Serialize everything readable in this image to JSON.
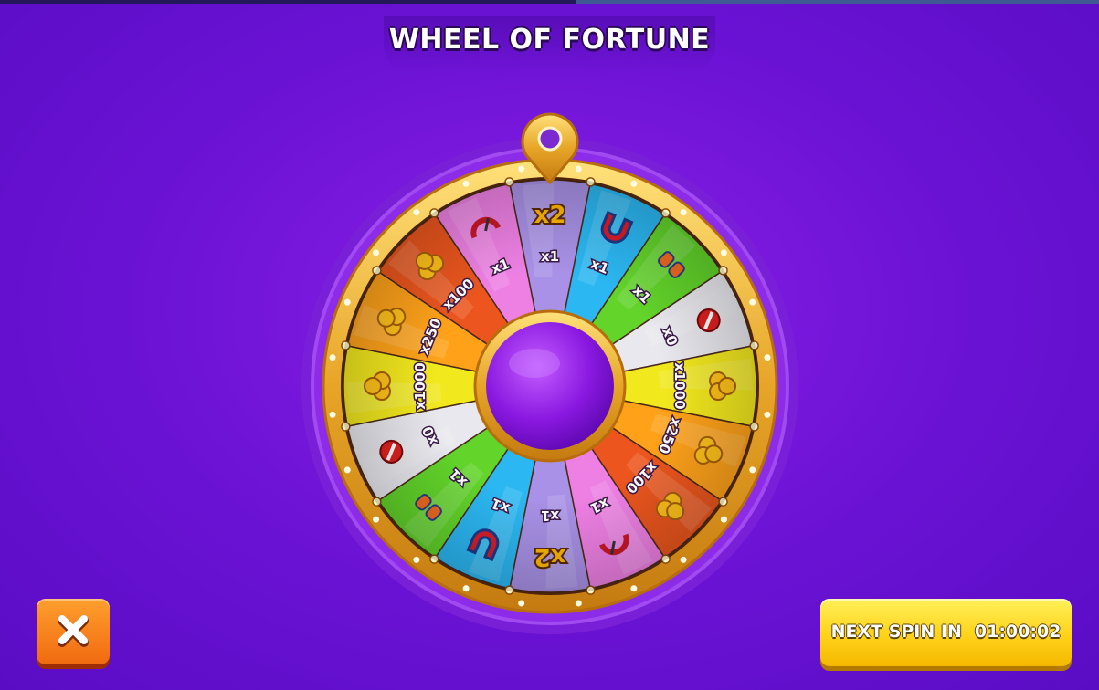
{
  "title": "WHEEL OF FORTUNE",
  "wheel": {
    "segments": [
      {
        "label": "x2",
        "icon": "x2-badge",
        "color": "#a891e6"
      },
      {
        "label": "x1",
        "icon": "magnet-icon",
        "color": "#2bb7f2"
      },
      {
        "label": "x1",
        "icon": "binoculars-icon",
        "color": "#62d42a"
      },
      {
        "label": "x0",
        "icon": "no-entry-icon",
        "color": "#e8e8ee"
      },
      {
        "label": "x1000",
        "icon": "treasure-coins-icon",
        "color": "#f2e81e"
      },
      {
        "label": "x250",
        "icon": "coins-pile-icon",
        "color": "#ffa21a"
      },
      {
        "label": "x100",
        "icon": "coins-icon",
        "color": "#ec561e"
      },
      {
        "label": "x1",
        "icon": "speedometer-icon",
        "color": "#ee80e4"
      },
      {
        "label": "x1",
        "icon": "x2-badge",
        "color": "#a891e6"
      },
      {
        "label": "x1",
        "icon": "magnet-icon",
        "color": "#2bb7f2"
      },
      {
        "label": "x1",
        "icon": "binoculars-icon",
        "color": "#62d42a"
      },
      {
        "label": "x0",
        "icon": "no-entry-icon",
        "color": "#e8e8ee"
      },
      {
        "label": "x1000",
        "icon": "treasure-coins-icon",
        "color": "#f2e81e"
      },
      {
        "label": "x250",
        "icon": "coins-pile-icon",
        "color": "#ffa21a"
      },
      {
        "label": "x100",
        "icon": "coins-icon",
        "color": "#ec561e"
      },
      {
        "label": "x1",
        "icon": "speedometer-icon",
        "color": "#ee80e4"
      }
    ],
    "badge_top": "x2",
    "badge_bottom": "x2"
  },
  "close_button": {
    "icon": "close-icon",
    "color": "#f47a18"
  },
  "next_spin": {
    "label": "NEXT SPIN IN",
    "timer": "01:00:02",
    "color": "#ffd21a"
  }
}
